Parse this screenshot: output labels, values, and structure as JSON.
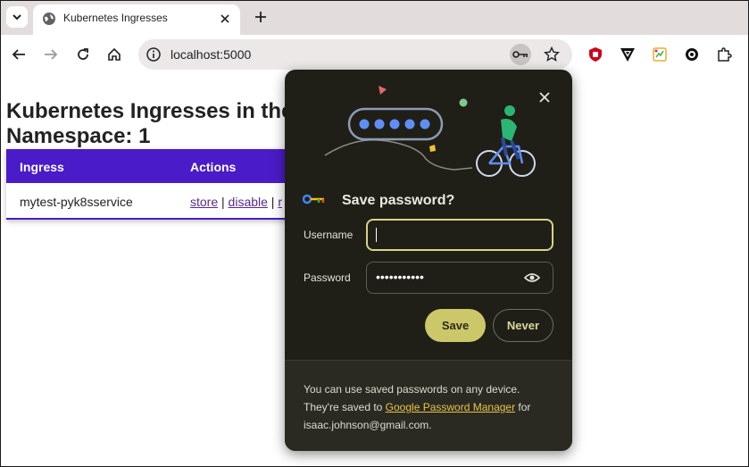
{
  "browser": {
    "tab": {
      "title": "Kubernetes Ingresses",
      "close_glyph": "✕"
    },
    "new_tab_glyph": "+",
    "url": "localhost:5000"
  },
  "page": {
    "title_line1": "Kubernetes Ingresses in the",
    "title_line2": "Namespace: 1",
    "table": {
      "headers": [
        "Ingress",
        "Actions"
      ],
      "rows": [
        {
          "ingress": "mytest-pyk8sservice",
          "action1": "store",
          "sep1": " | ",
          "action2": "disable",
          "sep2": " | ",
          "action3": "r"
        }
      ]
    }
  },
  "password_popup": {
    "heading": "Save password?",
    "username_label": "Username",
    "username_value": "",
    "password_label": "Password",
    "password_value": "•••••••••••",
    "save_label": "Save",
    "never_label": "Never",
    "footer_prefix": "You can use saved passwords on any device. They're saved to ",
    "footer_link": "Google Password Manager",
    "footer_suffix": " for isaac.johnson@gmail.com.",
    "close_glyph": "✕"
  },
  "colors": {
    "table_header": "#4a1bc8",
    "popup_bg": "#1f1f18",
    "save_button": "#ccc86a",
    "link": "#e7c34a"
  },
  "icons": [
    "tab-search-icon",
    "globe-favicon-icon",
    "close-icon",
    "new-tab-icon",
    "back-icon",
    "forward-icon",
    "reload-icon",
    "home-icon",
    "site-info-icon",
    "key-icon",
    "bookmark-star-icon",
    "ublock-icon",
    "vivaldi-like-icon",
    "color-ext-icon",
    "gear-ext-icon",
    "extensions-puzzle-icon",
    "eye-icon"
  ]
}
